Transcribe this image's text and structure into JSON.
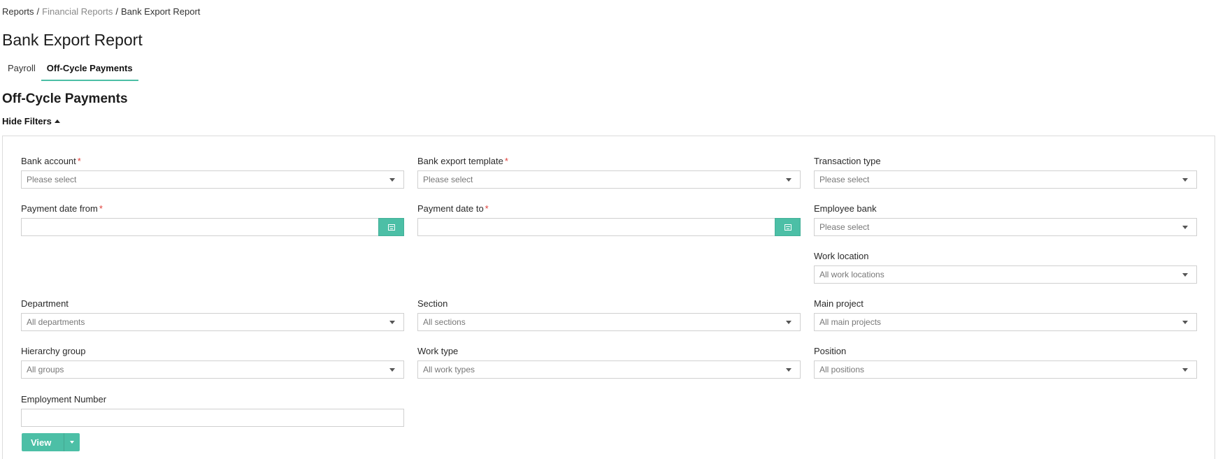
{
  "breadcrumb": {
    "items": [
      "Reports",
      "Financial Reports",
      "Bank Export Report"
    ],
    "separator": "/"
  },
  "page": {
    "title": "Bank Export Report",
    "section_title": "Off-Cycle Payments"
  },
  "tabs": [
    {
      "label": "Payroll",
      "active": false
    },
    {
      "label": "Off-Cycle Payments",
      "active": true
    }
  ],
  "filters_toggle": {
    "label": "Hide Filters"
  },
  "fields": {
    "bank_account": {
      "label": "Bank account",
      "required": "*",
      "placeholder": "Please select"
    },
    "bank_export_template": {
      "label": "Bank export template",
      "required": "*",
      "placeholder": "Please select"
    },
    "transaction_type": {
      "label": "Transaction type",
      "placeholder": "Please select"
    },
    "payment_date_from": {
      "label": "Payment date from",
      "required": "*",
      "value": ""
    },
    "payment_date_to": {
      "label": "Payment date to",
      "required": "*",
      "value": ""
    },
    "employee_bank": {
      "label": "Employee bank",
      "placeholder": "Please select"
    },
    "work_location": {
      "label": "Work location",
      "placeholder": "All work locations"
    },
    "department": {
      "label": "Department",
      "placeholder": "All departments"
    },
    "section": {
      "label": "Section",
      "placeholder": "All sections"
    },
    "main_project": {
      "label": "Main project",
      "placeholder": "All main projects"
    },
    "hierarchy_group": {
      "label": "Hierarchy group",
      "placeholder": "All groups"
    },
    "work_type": {
      "label": "Work type",
      "placeholder": "All work types"
    },
    "position": {
      "label": "Position",
      "placeholder": "All positions"
    },
    "employment_number": {
      "label": "Employment Number",
      "value": ""
    }
  },
  "actions": {
    "view_label": "View"
  },
  "icons": {
    "calendar": "calendar-icon",
    "dropdown": "chevron-down-icon",
    "collapse": "caret-up-icon"
  },
  "colors": {
    "accent": "#4cbfa6",
    "required": "#e0403a",
    "breadcrumb_muted": "#8a8a8a"
  }
}
